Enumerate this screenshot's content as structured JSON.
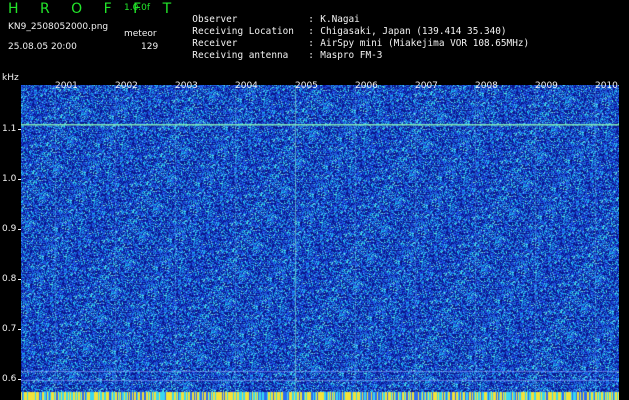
{
  "header": {
    "app_name": "H R O F F T",
    "version": "1.0.0f",
    "filename": "KN9_2508052000.png",
    "datetime": "25.08.05 20:00",
    "mode": "meteor",
    "count": "129"
  },
  "metadata": [
    {
      "key": "Observer",
      "value": "K.Nagai"
    },
    {
      "key": "Receiving Location",
      "value": "Chigasaki, Japan (139.414 35.340)"
    },
    {
      "key": "Receiver",
      "value": "AirSpy mini (Miakejima VOR 108.65MHz)"
    },
    {
      "key": "Receiving antenna",
      "value": "Maspro FM-3"
    }
  ],
  "axis": {
    "unit": "kHz",
    "y_ticks": [
      "1.1",
      "1.0",
      "0.9",
      "0.8",
      "0.7",
      "0.6"
    ],
    "x_labels": [
      "2001",
      "2002",
      "2003",
      "2004",
      "2005",
      "2006",
      "2007",
      "2008",
      "2009",
      "2010"
    ]
  },
  "colors": {
    "background": "#000000",
    "title_green": "#22e62a",
    "noise_base": "#1d3fc0",
    "signal_line": "#7fe8b8"
  }
}
